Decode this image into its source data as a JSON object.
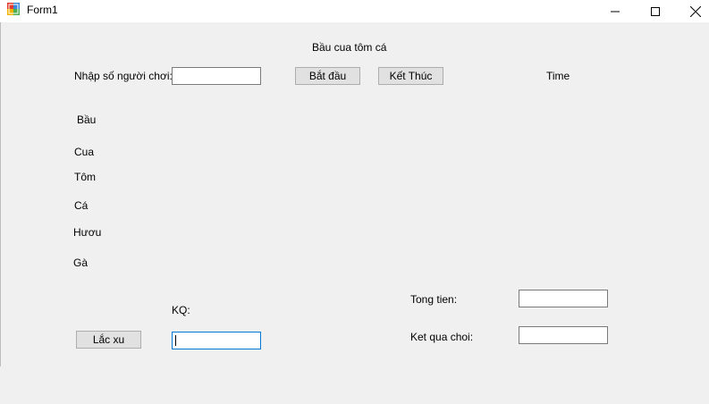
{
  "window": {
    "title": "Form1"
  },
  "header": {
    "game_title": "Bầu cua tôm cá",
    "players_label": "Nhập số người chơi:",
    "players_value": "",
    "start_button": "Bắt đầu",
    "end_button": "Kết Thúc",
    "time_label": "Time"
  },
  "animals": {
    "bau": "Bầu",
    "cua": "Cua",
    "tom": "Tôm",
    "ca": "Cá",
    "huou": "Hươu",
    "ga": "Gà"
  },
  "bottom": {
    "kq_label": "KQ:",
    "kq_value": "",
    "shake_button": "Lắc xu",
    "total_label": "Tong tien:",
    "total_value": "",
    "result_label": "Ket qua choi:",
    "result_value": ""
  },
  "colors": {
    "button_bg": "#e1e1e1",
    "focus_border": "#0078d7"
  }
}
